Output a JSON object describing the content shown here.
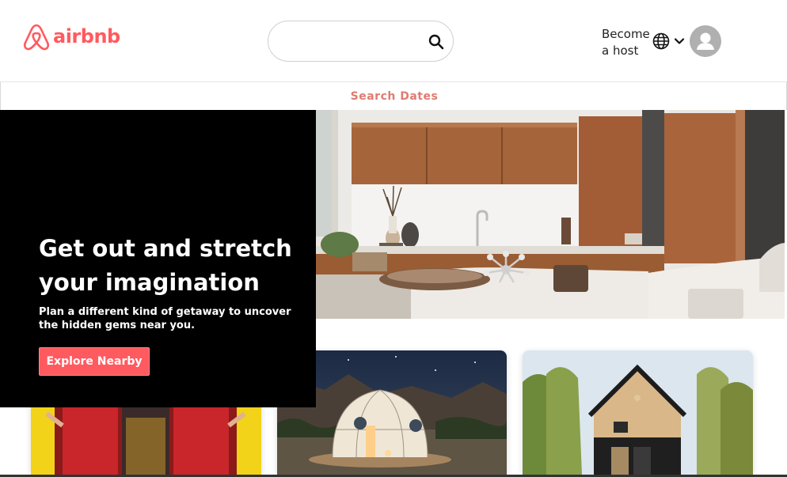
{
  "header": {
    "logo_text": "airbnb",
    "search": {
      "placeholder": "",
      "value": ""
    },
    "host_line1": "Become",
    "host_line2": "a host"
  },
  "dates_bar": {
    "label": "Search Dates"
  },
  "hero": {
    "title_line1": "Get out and stretch",
    "title_line2": "your imagination",
    "subtitle": "Plan a different kind of getaway to uncover the hidden gems near you.",
    "button_label": "Explore Nearby"
  },
  "colors": {
    "brand": "#ff5a5f",
    "dates_text": "#e07b72",
    "panel": "#000000"
  },
  "icons": [
    "airbnb-logo-icon",
    "search-icon",
    "globe-icon",
    "chevron-down-icon",
    "user-avatar-icon"
  ]
}
